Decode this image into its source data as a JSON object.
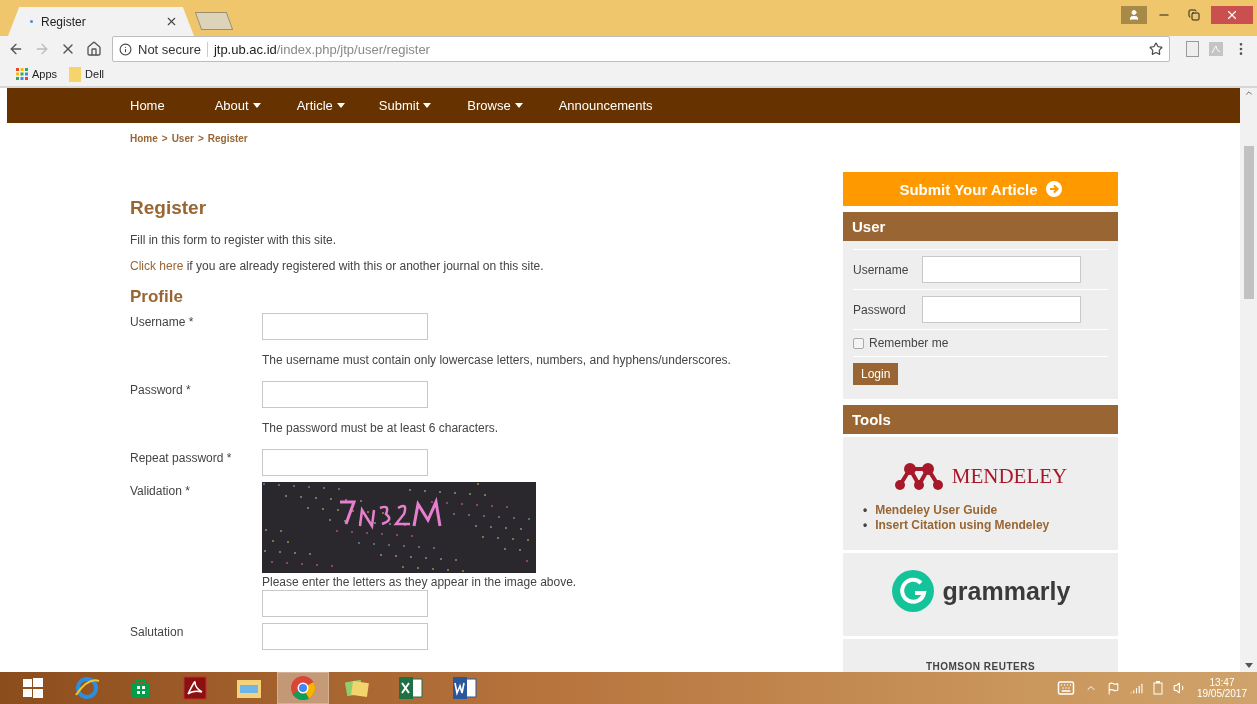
{
  "browser": {
    "tab": {
      "title": "Register"
    },
    "omnibox": {
      "security": "Not secure",
      "host": "jtp.ub.ac.id",
      "path": "/index.php/jtp/user/register"
    },
    "bookmarks": [
      {
        "kind": "apps",
        "label": "Apps"
      },
      {
        "kind": "folder",
        "label": "Dell"
      }
    ]
  },
  "nav": [
    {
      "label": "Home",
      "dropdown": false
    },
    {
      "label": "About",
      "dropdown": true
    },
    {
      "label": "Article",
      "dropdown": true
    },
    {
      "label": "Submit",
      "dropdown": true
    },
    {
      "label": "Browse",
      "dropdown": true
    },
    {
      "label": "Announcements",
      "dropdown": false
    }
  ],
  "breadcrumb": {
    "separator": ">",
    "items": [
      "Home",
      "User",
      "Register"
    ]
  },
  "register": {
    "title": "Register",
    "intro": "Fill in this form to register with this site.",
    "login_link": "Click here",
    "login_note": "if you are already registered with this or another journal on this site."
  },
  "profile": {
    "title": "Profile",
    "fields": [
      {
        "kind": "input",
        "label": "Username *",
        "hint": "The username must contain only lowercase letters, numbers, and hyphens/underscores."
      },
      {
        "kind": "input",
        "label": "Password *",
        "hint": "The password must be at least 6 characters."
      },
      {
        "kind": "input",
        "label": "Repeat password *"
      },
      {
        "kind": "captcha",
        "label": "Validation *",
        "hint": "Please enter the letters as they appear in the image above."
      },
      {
        "kind": "input",
        "label": "Salutation"
      }
    ]
  },
  "sidebar": {
    "submit_button": "Submit Your Article",
    "user": {
      "title": "User",
      "fields": [
        "Username",
        "Password"
      ],
      "remember": {
        "label": "Remember me",
        "checked": false
      },
      "login_button": "Login"
    },
    "tools": {
      "title": "Tools",
      "cards": [
        {
          "kind": "mendeley",
          "logo": "MENDELEY",
          "links": [
            {
              "marker": "•",
              "label": "Mendeley User Guide"
            },
            {
              "marker": "•",
              "label": "Insert Citation using Mendeley"
            }
          ]
        },
        {
          "kind": "grammarly",
          "logo": "grammarly"
        },
        {
          "kind": "thomson",
          "logo": "THOMSON REUTERS"
        }
      ]
    }
  },
  "taskbar": {
    "apps": [
      {
        "kind": "ie",
        "selected": false
      },
      {
        "kind": "store",
        "selected": false
      },
      {
        "kind": "acrobat",
        "selected": false
      },
      {
        "kind": "explorer",
        "selected": false
      },
      {
        "kind": "chrome",
        "selected": true
      },
      {
        "kind": "photos",
        "selected": false
      },
      {
        "kind": "excel",
        "selected": false
      },
      {
        "kind": "word",
        "selected": false
      }
    ],
    "time": "13:47",
    "date": "19/05/2017"
  }
}
